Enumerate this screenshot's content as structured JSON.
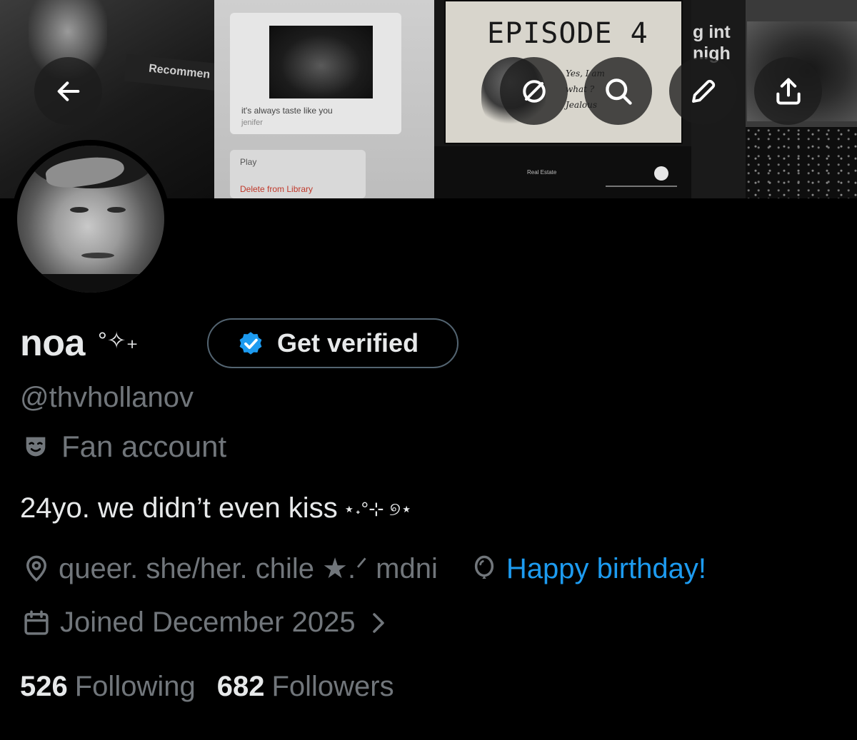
{
  "banner": {
    "recommended_text": "Recommen",
    "song_caption": "it's always taste like you",
    "song_artist": "jenifer",
    "menu_play": "Play",
    "menu_delete": "Delete from Library",
    "episode_title": "EPISODE 4",
    "handwritten_note": [
      "Yes, I am",
      "what ?",
      "Jealous"
    ],
    "player_track": "Real Estate",
    "side_text": [
      "g int",
      "nigh"
    ]
  },
  "header_buttons": {
    "back": "arrow-left-icon",
    "hide": "eye-slash-icon",
    "search": "search-icon",
    "edit": "pencil-icon",
    "share": "share-icon"
  },
  "profile": {
    "display_name": "noa",
    "name_decoration": "°✧₊",
    "verify_label": "Get verified",
    "handle": "@thvhollanov",
    "category": "Fan account",
    "bio": "24yo. we didn’t even kiss",
    "bio_decoration": "⋆˖°⊹ ୭⋆",
    "location": "queer. she/her. chile ★.ᐟ mdni",
    "birthday": "Happy birthday!",
    "joined": "Joined December 2025"
  },
  "stats": {
    "following_count": "526",
    "following_label": "Following",
    "followers_count": "682",
    "followers_label": "Followers"
  },
  "colors": {
    "background": "#000000",
    "primary_text": "#e7e9ea",
    "secondary_text": "#71767b",
    "link_blue": "#1d9bf0",
    "verify_badge": "#1d9bf0"
  }
}
